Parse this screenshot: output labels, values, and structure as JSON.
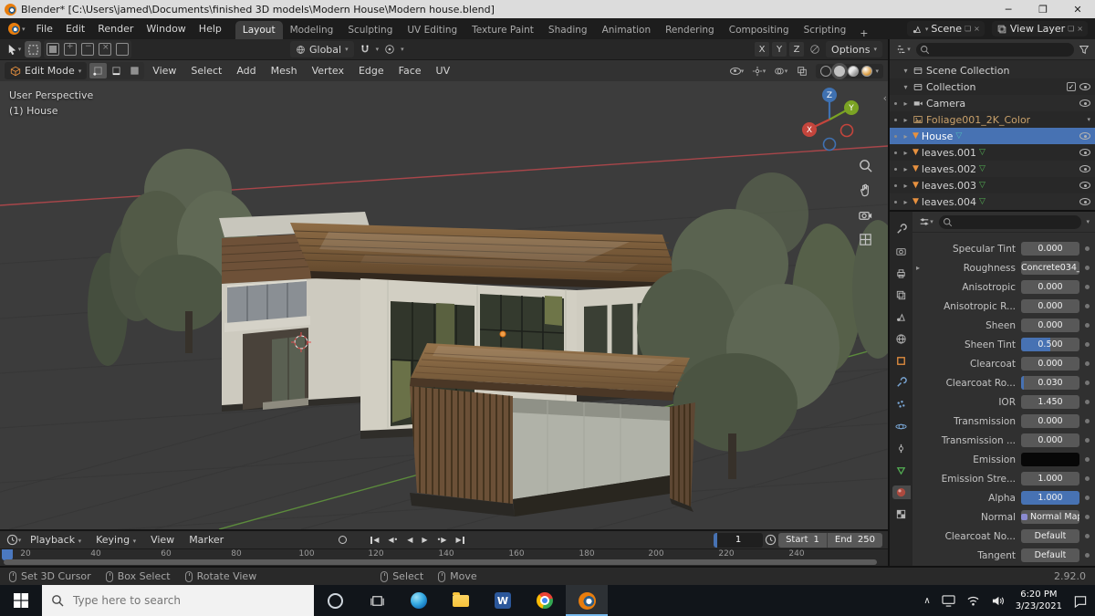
{
  "window": {
    "title": "Blender* [C:\\Users\\jamed\\Documents\\finished 3D models\\Modern House\\Modern house.blend]"
  },
  "menubar": {
    "menus": [
      "File",
      "Edit",
      "Render",
      "Window",
      "Help"
    ],
    "workspaces": [
      "Layout",
      "Modeling",
      "Sculpting",
      "UV Editing",
      "Texture Paint",
      "Shading",
      "Animation",
      "Rendering",
      "Compositing",
      "Scripting"
    ],
    "add_workspace": "+",
    "scene_selector": "Scene",
    "view_layer_selector": "View Layer"
  },
  "tool_header": {
    "orientation": "Global",
    "axes": [
      "X",
      "Y",
      "Z"
    ],
    "options": "Options"
  },
  "viewport_header": {
    "mode": "Edit Mode",
    "menus": [
      "View",
      "Select",
      "Add",
      "Mesh",
      "Vertex",
      "Edge",
      "Face",
      "UV"
    ]
  },
  "viewport": {
    "perspective": "User Perspective",
    "object": "(1) House",
    "gizmo": {
      "x": "X",
      "y": "Y",
      "z": "Z"
    }
  },
  "outliner": {
    "rows": [
      {
        "label": "Scene Collection"
      },
      {
        "label": "Collection"
      },
      {
        "label": "Camera"
      },
      {
        "label": "Foliage001_2K_Color"
      },
      {
        "label": "House"
      },
      {
        "label": "leaves.001"
      },
      {
        "label": "leaves.002"
      },
      {
        "label": "leaves.003"
      },
      {
        "label": "leaves.004"
      }
    ]
  },
  "properties": {
    "rows": [
      {
        "label": "Specular Tint",
        "value": "0.000"
      },
      {
        "label": "Roughness",
        "value": "Concrete034_2..."
      },
      {
        "label": "Anisotropic",
        "value": "0.000"
      },
      {
        "label": "Anisotropic R...",
        "value": "0.000"
      },
      {
        "label": "Sheen",
        "value": "0.000"
      },
      {
        "label": "Sheen Tint",
        "value": "0.500"
      },
      {
        "label": "Clearcoat",
        "value": "0.000"
      },
      {
        "label": "Clearcoat Ro...",
        "value": "0.030"
      },
      {
        "label": "IOR",
        "value": "1.450"
      },
      {
        "label": "Transmission",
        "value": "0.000"
      },
      {
        "label": "Transmission ...",
        "value": "0.000"
      },
      {
        "label": "Emission",
        "value": ""
      },
      {
        "label": "Emission Stre...",
        "value": "1.000"
      },
      {
        "label": "Alpha",
        "value": "1.000"
      },
      {
        "label": "Normal",
        "value": "Normal Map"
      },
      {
        "label": "Clearcoat No...",
        "value": "Default"
      },
      {
        "label": "Tangent",
        "value": "Default"
      }
    ]
  },
  "timeline": {
    "menus": [
      "Playback",
      "Keying",
      "View",
      "Marker"
    ],
    "current_frame": "1",
    "start_label": "Start",
    "start_value": "1",
    "end_label": "End",
    "end_value": "250",
    "ticks": [
      "20",
      "40",
      "60",
      "80",
      "100",
      "120",
      "140",
      "160",
      "180",
      "200",
      "220",
      "240"
    ]
  },
  "statusbar": {
    "hints": [
      "Set 3D Cursor",
      "Box Select",
      "Rotate View",
      "Select",
      "Move"
    ],
    "version": "2.92.0"
  },
  "taskbar": {
    "search_placeholder": "Type here to search",
    "time": "6:20 PM",
    "date": "3/23/2021"
  }
}
